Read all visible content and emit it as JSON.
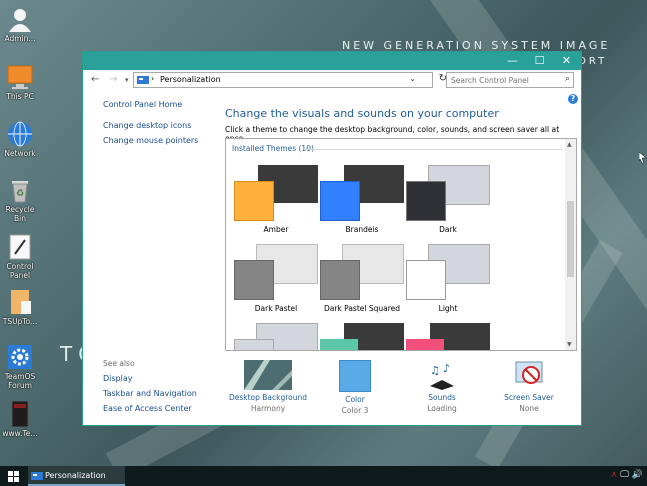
{
  "wallpaper": {
    "title": "NEW GENERATION SYSTEM IMAGE",
    "subtitle": "ORT",
    "brand": "TO"
  },
  "desktop_icons": [
    {
      "label": "Admin..."
    },
    {
      "label": "This PC"
    },
    {
      "label": "Network"
    },
    {
      "label": "Recycle Bin"
    },
    {
      "label": "Control Panel"
    },
    {
      "label": "TSUpTo..."
    },
    {
      "label": "TeamOS Forum"
    },
    {
      "label": "www.Te..."
    }
  ],
  "window": {
    "controls": {
      "minimize": "—",
      "maximize": "☐",
      "close": "✕"
    },
    "address": {
      "separator": "›",
      "location": "Personalization"
    },
    "search": {
      "placeholder": "Search Control Panel",
      "value": ""
    },
    "left_links": [
      {
        "label": "Control Panel Home"
      },
      {
        "label": "Change desktop icons"
      },
      {
        "label": "Change mouse pointers"
      }
    ],
    "see_also": {
      "header": "See also",
      "links": [
        {
          "label": "Display"
        },
        {
          "label": "Taskbar and Navigation"
        },
        {
          "label": "Ease of Access Center"
        }
      ]
    },
    "help_label": "?",
    "main_title": "Change the visuals and sounds on your computer",
    "main_desc": "Click a theme to change the desktop background, color, sounds, and screen saver all at once.",
    "themes_header": "Installed Themes (10)",
    "themes": [
      {
        "name": "Amber",
        "back": "#3a3a3a",
        "front": "#ffb13b"
      },
      {
        "name": "Brandeis",
        "back": "#3a3a3a",
        "front": "#3080ff"
      },
      {
        "name": "Dark",
        "back": "#d3d6dc",
        "front": "#2e3036"
      },
      {
        "name": "Dark Pastel",
        "back": "#e7e7e7",
        "front": "#858585"
      },
      {
        "name": "Dark Pastel Squared",
        "back": "#e7e7e7",
        "front": "#858585"
      },
      {
        "name": "Light",
        "back": "#d3d6dc",
        "front": "#ffffff"
      },
      {
        "name": "",
        "back": "#d3d6dc",
        "front": "#d3d6dc"
      },
      {
        "name": "",
        "back": "#3a3a3a",
        "front": "#5cc6a8"
      },
      {
        "name": "",
        "back": "#3a3a3a",
        "front": "#f0507a"
      }
    ],
    "bottom": [
      {
        "title": "Desktop Background",
        "value": "Harmony",
        "icon": "wallpaper-thumb-icon"
      },
      {
        "title": "Color",
        "value": "Color 3",
        "icon": "color-swatch-icon"
      },
      {
        "title": "Sounds",
        "value": "Loading",
        "icon": "music-notes-icon"
      },
      {
        "title": "Screen Saver",
        "value": "None",
        "icon": "screen-saver-icon"
      }
    ]
  },
  "taskbar": {
    "task_label": "Personalization"
  },
  "colors": {
    "accent": "#2aa198",
    "link": "#1a4d8f",
    "heading": "#1f5c99"
  }
}
